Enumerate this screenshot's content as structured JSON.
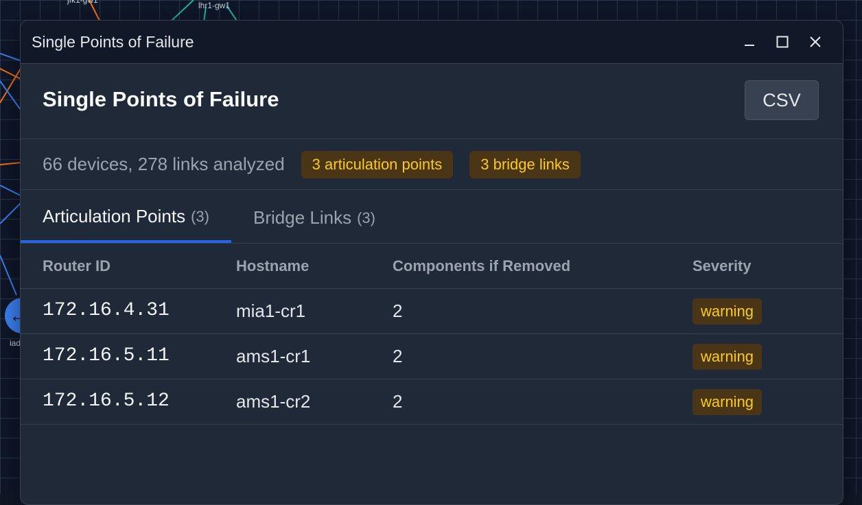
{
  "background": {
    "node_labels": [
      "jfk1-gw1",
      "lhr1-gw1",
      "iad"
    ],
    "node_icon": "arrow-left-icon"
  },
  "window": {
    "title": "Single Points of Failure",
    "controls": [
      "minimize-icon",
      "maximize-icon",
      "close-icon"
    ]
  },
  "header": {
    "title": "Single Points of Failure",
    "csv_label": "CSV"
  },
  "summary": {
    "text": "66 devices, 278 links analyzed",
    "badges": [
      "3 articulation points",
      "3 bridge links"
    ]
  },
  "tabs": [
    {
      "label": "Articulation Points",
      "count": "(3)",
      "active": true
    },
    {
      "label": "Bridge Links",
      "count": "(3)",
      "active": false
    }
  ],
  "table": {
    "columns": [
      "Router ID",
      "Hostname",
      "Components if Removed",
      "Severity"
    ],
    "rows": [
      {
        "router_id": "172.16.4.31",
        "hostname": "mia1-cr1",
        "components": "2",
        "severity": "warning"
      },
      {
        "router_id": "172.16.5.11",
        "hostname": "ams1-cr1",
        "components": "2",
        "severity": "warning"
      },
      {
        "router_id": "172.16.5.12",
        "hostname": "ams1-cr2",
        "components": "2",
        "severity": "warning"
      }
    ]
  },
  "colors": {
    "accent": "#2563eb",
    "warning_text": "#facc15",
    "warning_bg": "#4a3517",
    "panel": "#1f2937",
    "canvas": "#111827"
  }
}
